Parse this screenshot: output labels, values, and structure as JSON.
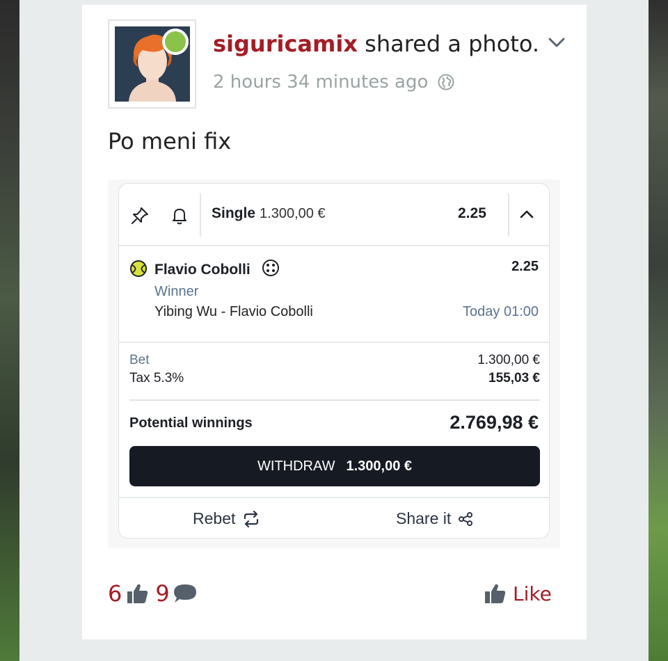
{
  "post": {
    "username": "siguricamix",
    "action_text": " shared a photo.",
    "time_ago": "2 hours 34 minutes ago",
    "text": "Po meni fix"
  },
  "bet_slip": {
    "type": "Single",
    "stake": "1.300,00 €",
    "total_odds": "2.25",
    "selection": {
      "player": "Flavio Cobolli",
      "odds": "2.25",
      "market": "Winner",
      "match": "Yibing Wu - Flavio Cobolli",
      "time": "Today 01:00"
    },
    "bet_label": "Bet",
    "bet_amount": "1.300,00 €",
    "tax_label": "Tax 5.3%",
    "tax_amount": "155,03 €",
    "winnings_label": "Potential winnings",
    "winnings_amount": "2.769,98 €",
    "withdraw_label": "WITHDRAW",
    "withdraw_amount": "1.300,00 €",
    "rebet_label": "Rebet",
    "share_label": "Share it"
  },
  "reactions": {
    "likes_count": "6",
    "comments_count": "9",
    "like_label": "Like"
  },
  "colors": {
    "brand": "#a31d26",
    "online": "#8bc34a",
    "button_dark": "#161a23",
    "muted_blue": "#5d7390"
  },
  "icons": {
    "options": "chevron-down-icon",
    "visibility": "globe-icon",
    "pin": "pin-icon",
    "notify": "bell-icon",
    "collapse": "chevron-up-icon",
    "sport": "tennis-ball-icon",
    "stats": "stats-icon",
    "rebet": "repeat-icon",
    "share": "share-icon",
    "likes": "thumbs-up-icon",
    "comments": "comment-icon",
    "like_action": "thumbs-up-icon"
  }
}
